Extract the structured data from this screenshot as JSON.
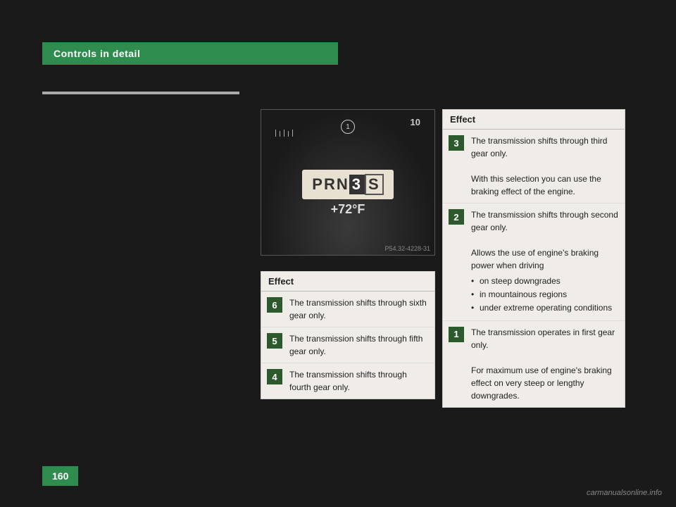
{
  "header": {
    "title": "Controls in detail"
  },
  "dashboard": {
    "prn": "PRN",
    "gear": "3",
    "selector": "S",
    "temp": "+72°F",
    "caption": "P54.32-4228-31",
    "circle_label": "1",
    "gauge_number": "10"
  },
  "table_left": {
    "header": "Effect",
    "rows": [
      {
        "gear": "6",
        "text": "The transmission shifts through sixth gear only."
      },
      {
        "gear": "5",
        "text": "The transmission shifts through fifth gear only."
      },
      {
        "gear": "4",
        "text": "The transmission shifts through fourth gear only."
      }
    ]
  },
  "table_right": {
    "header": "Effect",
    "rows": [
      {
        "gear": "3",
        "text_main": "The transmission shifts through third gear only.",
        "text_sub": "With this selection you can use the braking effect of the engine.",
        "bullets": []
      },
      {
        "gear": "2",
        "text_main": "The transmission shifts through second gear only.",
        "text_sub": "Allows the use of engine's braking power when driving",
        "bullets": [
          "on steep downgrades",
          "in mountainous regions",
          "under extreme operating conditions"
        ]
      },
      {
        "gear": "1",
        "text_main": "The transmission operates in first gear only.",
        "text_sub": "For maximum use of engine's braking effect on very steep or lengthy downgrades.",
        "bullets": []
      }
    ]
  },
  "page": {
    "number": "160"
  },
  "logo": {
    "text": "carmanualsonline.info"
  }
}
